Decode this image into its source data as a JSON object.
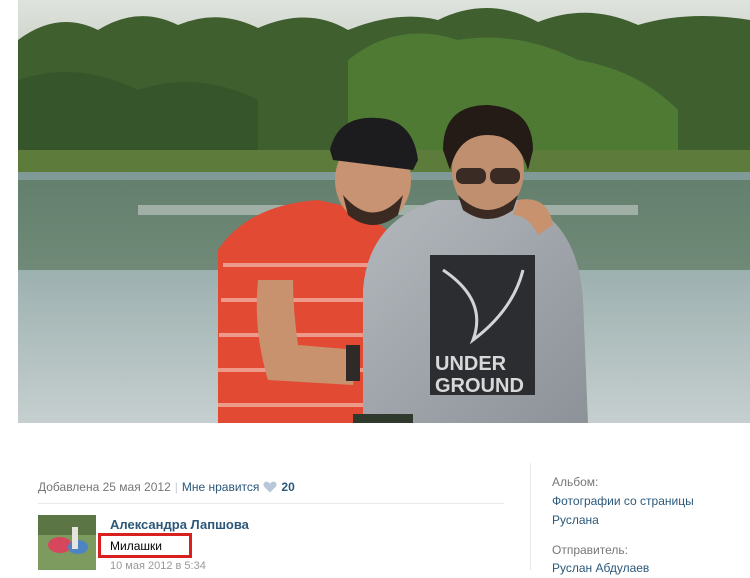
{
  "photo": {
    "description_icon": "photo-image",
    "sweatshirt_print": "UNDERGROUND"
  },
  "photo_meta": {
    "added": "Добавлена 25 мая 2012",
    "separator": "|",
    "like_label": "Мне нравится",
    "like_count": "20"
  },
  "comment": {
    "author": "Александра Лапшова",
    "text": "Милашки",
    "date": "10 мая 2012 в 5:34",
    "highlight_color": "#d9201f"
  },
  "sidebar": {
    "album_label": "Альбом:",
    "album_name_line1": "Фотографии со страницы",
    "album_name_line2": "Руслана",
    "sender_label": "Отправитель:",
    "sender_name": "Руслан Абдулаев"
  },
  "colors": {
    "link": "#2b587a",
    "muted": "#777777",
    "heart": "#b9c8d8"
  }
}
